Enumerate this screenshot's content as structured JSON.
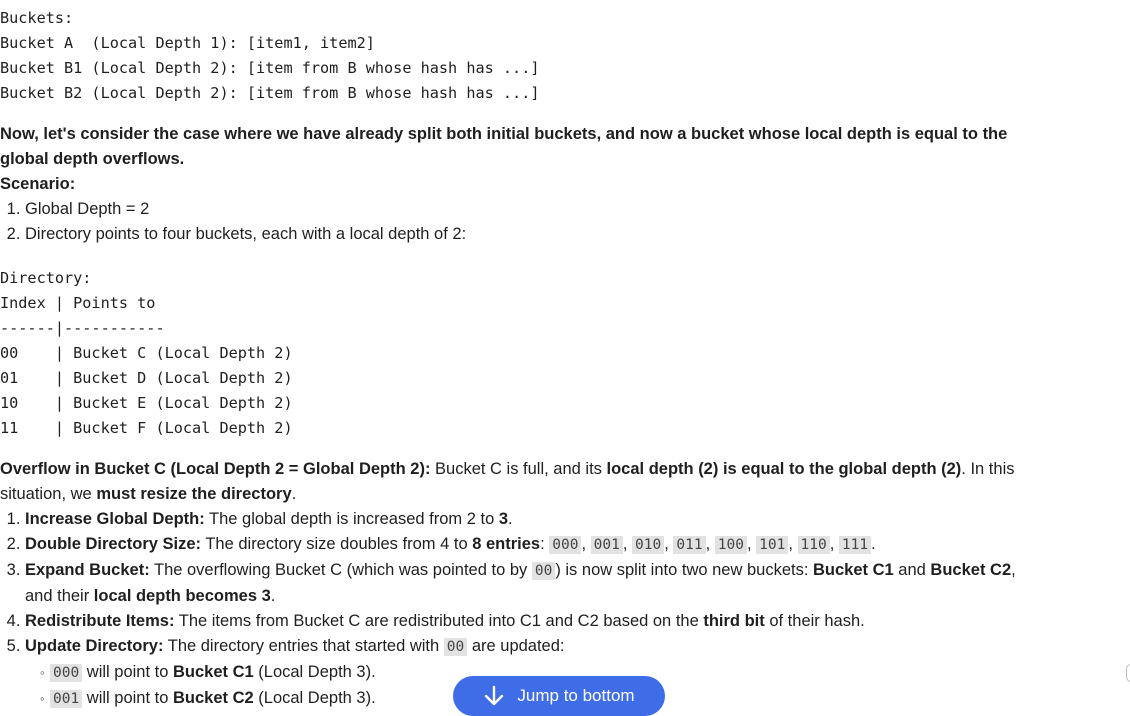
{
  "buckets_block": {
    "lines": [
      "Buckets:",
      "Bucket A  (Local Depth 1): [item1, item2]",
      "Bucket B1 (Local Depth 2): [item from B whose hash has ...]",
      "Bucket B2 (Local Depth 2): [item from B whose hash has ...]"
    ]
  },
  "intro": {
    "text": "Now, let's consider the case where we have already split both initial buckets, and now a bucket whose local depth is equal to the global depth overflows."
  },
  "scenario": {
    "heading": "Scenario:",
    "items": [
      "Global Depth = 2",
      "Directory points to four buckets, each with a local depth of 2:"
    ]
  },
  "directory_block": {
    "lines": [
      "Directory:",
      "Index | Points to",
      "------|-----------",
      "00    | Bucket C (Local Depth 2)",
      "01    | Bucket D (Local Depth 2)",
      "10    | Bucket E (Local Depth 2)",
      "11    | Bucket F (Local Depth 2)"
    ]
  },
  "overflow": {
    "title": "Overflow in Bucket C (Local Depth 2 = Global Depth 2):",
    "t1": " Bucket C is full, and its ",
    "b1": "local depth (2) is equal to the global depth (2)",
    "t2": ". In this situation, we ",
    "b2": "must resize the directory",
    "t3": "."
  },
  "steps": [
    {
      "title": "Increase Global Depth:",
      "t1": " The global depth is increased from 2 to ",
      "b1": "3",
      "t2": "."
    },
    {
      "title": "Double Directory Size:",
      "t1": " The directory size doubles from 4 to ",
      "b1": "8 entries",
      "t2": ": ",
      "codes": [
        "000",
        "001",
        "010",
        "011",
        "100",
        "101",
        "110",
        "111"
      ]
    },
    {
      "title": "Expand Bucket:",
      "t1": " The overflowing Bucket C (which was pointed to by ",
      "code": "00",
      "t2": ") is now split into two new buckets: ",
      "b1": "Bucket C1",
      "t3": " and ",
      "b2": "Bucket C2",
      "t4": ", and their ",
      "b3": "local depth becomes 3",
      "t5": "."
    },
    {
      "title": "Redistribute Items:",
      "t1": " The items from Bucket C are redistributed into C1 and C2 based on the ",
      "b1": "third bit",
      "t2": " of their hash."
    },
    {
      "title": "Update Directory:",
      "t1": " The directory entries that started with ",
      "code": "00",
      "t2": " are updated:",
      "sub": [
        {
          "code": "000",
          "t1": " will point to ",
          "b1": "Bucket C1",
          "t2": " (Local Depth 3)."
        },
        {
          "code": "001",
          "t1": " will point to ",
          "b1": "Bucket C2",
          "t2": " (Local Depth 3)."
        }
      ]
    }
  ],
  "jump_button": {
    "label": "Jump to bottom",
    "icon": "arrow-down-icon"
  },
  "colors": {
    "button_bg": "#3f6ce7",
    "code_bg": "#e2e2e2"
  }
}
